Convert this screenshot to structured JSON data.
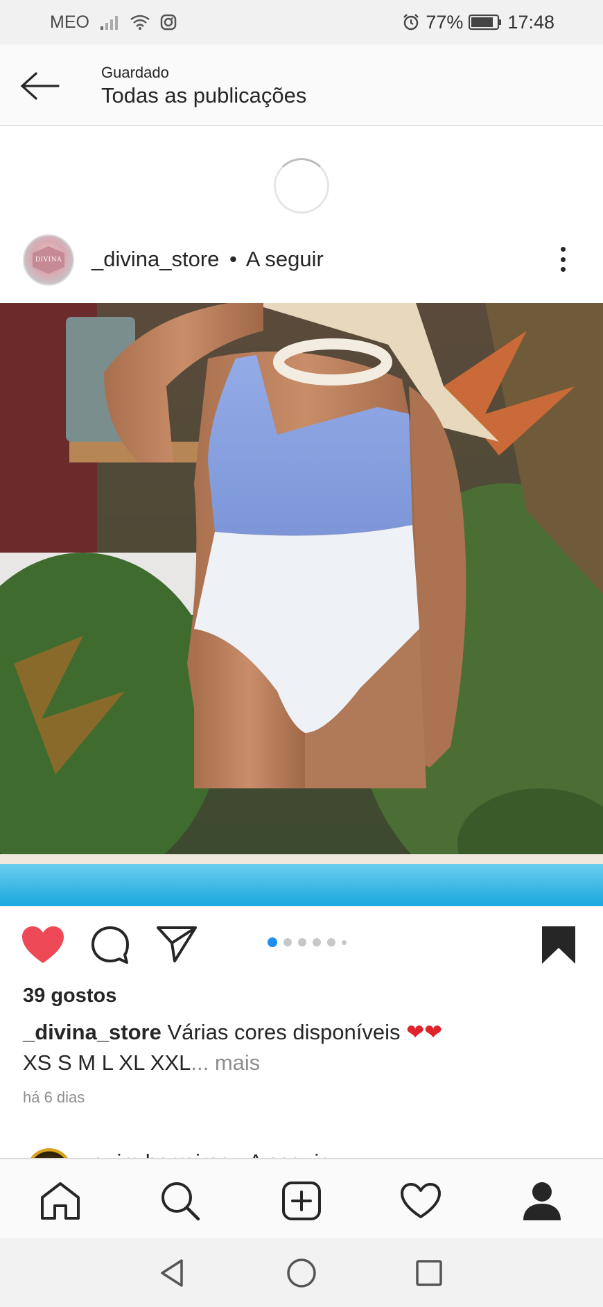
{
  "status_bar": {
    "carrier": "MEO",
    "battery": "77%",
    "time": "17:48",
    "icons": [
      "signal-icon",
      "wifi-icon",
      "instagram-icon",
      "alarm-icon",
      "battery-icon"
    ]
  },
  "header": {
    "subtitle": "Guardado",
    "title": "Todas as publicações",
    "back_icon": "arrow-left-icon"
  },
  "post": {
    "username": "_divina_store",
    "separator": "•",
    "follow_status": "A seguir",
    "avatar_text": "DIVINA",
    "likes": "39 gostos",
    "caption_user": "_divina_store",
    "caption_text": "Várias cores disponíveis",
    "caption_emoji": "❤❤",
    "caption_line2": "XS S M L XL XXL",
    "caption_more": "... mais",
    "time_ago": "há 6 dias",
    "carousel": {
      "count": 6,
      "active_index": 0
    },
    "liked": true,
    "saved": true,
    "accent": "#ed4956",
    "carousel_active_color": "#1e8ff0"
  },
  "next_post": {
    "username": "quim.barreiros",
    "separator": "•",
    "follow_status": "A seguir"
  },
  "bottom_nav": [
    "home-icon",
    "search-icon",
    "add-post-icon",
    "activity-heart-icon",
    "profile-icon"
  ],
  "system_nav": [
    "back-triangle-icon",
    "home-circle-icon",
    "recents-square-icon"
  ]
}
